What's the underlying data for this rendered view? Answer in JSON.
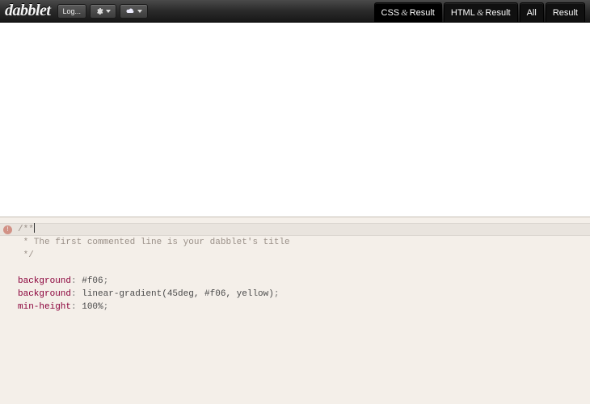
{
  "header": {
    "logo": "dabblet",
    "login_label": "Log...",
    "tabs": {
      "css_result": {
        "left": "CSS",
        "amp": "&",
        "right": "Result"
      },
      "html_result": {
        "left": "HTML",
        "amp": "&",
        "right": "Result"
      },
      "all": "All",
      "result": "Result"
    }
  },
  "editor": {
    "badge": "!",
    "lines": {
      "l1": "/**",
      "l2": " * The first commented line is your dabblet's title",
      "l3": " */",
      "blank": "",
      "l5_prop": "background",
      "l5_val": "#f06",
      "l6_prop": "background",
      "l6_val": "linear-gradient(45deg, #f06, yellow)",
      "l7_prop": "min-height",
      "l7_val": "100%",
      "colon": ": ",
      "semi": ";"
    }
  }
}
